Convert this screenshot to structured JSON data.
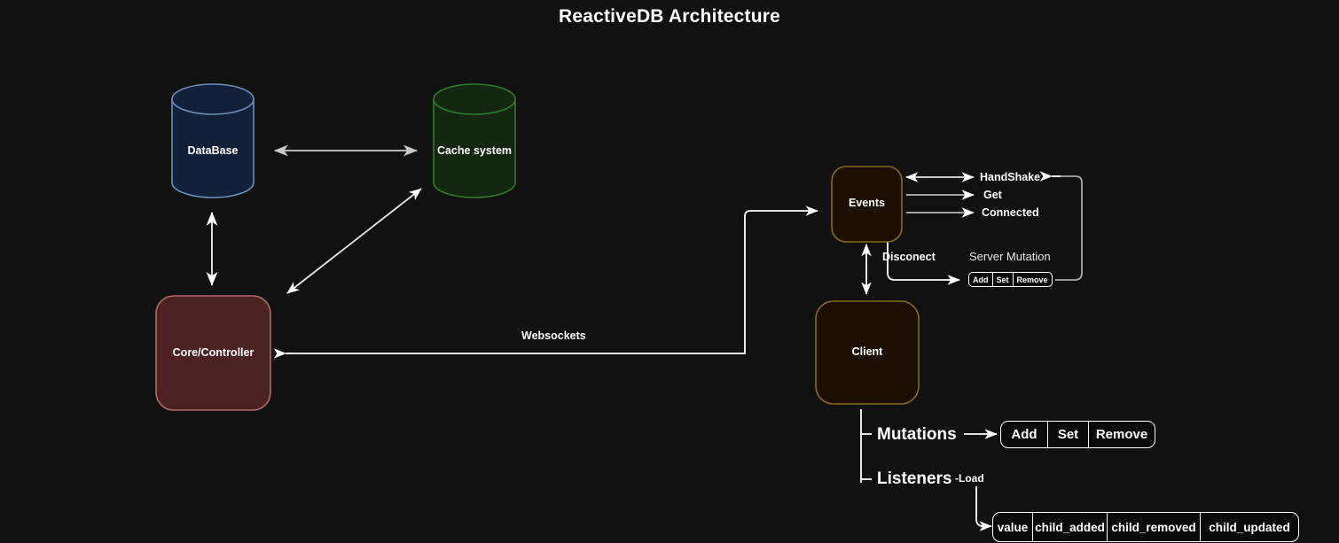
{
  "title": "ReactiveDB Architecture",
  "colors": {
    "background": "#111111",
    "database_fill": "#13203a",
    "database_stroke": "#6d90bb",
    "cache_fill": "#132711",
    "cache_stroke": "#2f7d2c",
    "core_fill": "#4d2222",
    "core_stroke": "#b06b6b",
    "events_fill": "#1c0f01",
    "events_stroke": "#8a6a16",
    "client_fill": "#1c0f01",
    "client_stroke": "#8a6a16",
    "edge": "#ffffff",
    "edge_muted": "#9a9a9a",
    "text": "#ffffff"
  },
  "nodes": {
    "database": {
      "label": "DataBase"
    },
    "cache": {
      "label": "Cache system"
    },
    "core": {
      "label": "Core/Controller"
    },
    "events": {
      "label": "Events"
    },
    "client": {
      "label": "Client"
    }
  },
  "edge_labels": {
    "websockets": "Websockets",
    "handshake": "HandShake",
    "get": "Get",
    "connected": "Connected",
    "disconect": "Disconect",
    "server_mutation": "Server Mutation",
    "mutations": "Mutations",
    "listeners": "Listeners",
    "load": "-Load"
  },
  "tables": {
    "server_mutation": {
      "caption": "Server Mutation",
      "cells": [
        "Add",
        "Set",
        "Remove"
      ]
    },
    "mutations": {
      "caption": "Mutations",
      "cells": [
        "Add",
        "Set",
        "Remove"
      ]
    },
    "listeners": {
      "caption": "Listeners",
      "cells": [
        "value",
        "child_added",
        "child_removed",
        "child_updated"
      ]
    }
  }
}
